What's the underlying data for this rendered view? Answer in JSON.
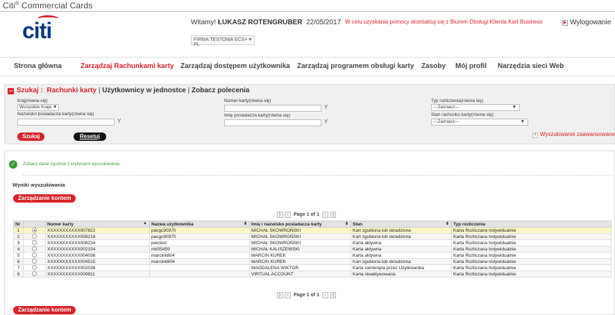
{
  "app": {
    "title_prefix": "Citi",
    "title_sup": "®",
    "title_suffix": " Commercial Cards",
    "logo": "citi"
  },
  "header": {
    "welcome_prefix": "Witamy! ",
    "user_name": "ŁUKASZ ROTENGRUBER",
    "date": "22/05/2017",
    "help_message": "W celu uzyskania pomocy skontaktuj się z Biurem Obsługi Klienta Kart Business",
    "logout_label": "Wylogowanie",
    "company_selected": "FIRMA TESTOWA ECS+ - PL"
  },
  "nav": {
    "items": [
      {
        "label": "Strona główna",
        "active": false
      },
      {
        "label": "Zarządzaj Rachunkami karty",
        "active": true
      },
      {
        "label": "Zarządzaj dostępem użytkownika",
        "active": false
      },
      {
        "label": "Zarządzaj programem obsługi karty",
        "active": false
      },
      {
        "label": "Zasoby",
        "active": false
      },
      {
        "label": "Mój profil",
        "active": false
      },
      {
        "label": "Narzędzia sieci Web",
        "active": false
      }
    ]
  },
  "search": {
    "heading_label": "Szukaj :",
    "tab_active": "Rachunki karty",
    "tab_2": "Użytkownicy w jednostce",
    "tab_3": "Zobacz polecenia",
    "separator": "|",
    "country_label": "Kraj(równa się)",
    "country_value": "Wszystkie Kraje ▼",
    "holder_name_label": "Nazwisko posiadacza karty(równa się)",
    "card_number_label": "Numer karty(równa się)",
    "first_name_label": "Imię posiadacza karty(równa się)",
    "billing_type_label": "Typ rozliczenia(równa się)",
    "billing_type_value": "---Zaznacz---",
    "account_status_label": "Stan rachunku karty(równa się)",
    "account_status_value": "---Zaznacz---",
    "search_button": "Szukaj",
    "reset_button": "Resetuj",
    "advanced_link": "Wyszukiwanie zaawansowane"
  },
  "results": {
    "success_message": "Zobacz dane zgodnie z kryteriami wyszukiwania.",
    "title": "Wyniki wyszukiwania",
    "manage_button": "Zarządzanie kontem",
    "page_text": "Page 1 of 1",
    "columns": [
      "Nr",
      "",
      "Numer karty",
      "Nazwa użytkownika",
      "Imię i nazwisko posiadacza karty",
      "Stan",
      "Typ rozliczenia"
    ],
    "rows": [
      {
        "nr": "1",
        "selected": true,
        "card": "XXXXXXXXXXX007822",
        "user": "pacgc90970",
        "name": "MICHAŁ SKOWROŃSKI",
        "status": "Kart zgubiona lub skradziona",
        "billing": "Karta Rozliczana Indywidualnie"
      },
      {
        "nr": "2",
        "selected": false,
        "card": "XXXXXXXXXXX008218",
        "user": "pacgc90970",
        "name": "MICHAŁ SKOWROŃSKI",
        "status": "Kart zgubiona lub skradziona",
        "billing": "Karta Rozliczana Indywidualnie"
      },
      {
        "nr": "3",
        "selected": false,
        "card": "XXXXXXXXXXX008234",
        "user": "pwctest",
        "name": "MICHAŁ SKOWROŃSKI",
        "status": "Karta aktywna",
        "billing": "Karta Rozliczana Indywidualnie"
      },
      {
        "nr": "4",
        "selected": false,
        "card": "XXXXXXXXXXX002154",
        "user": "mk55459",
        "name": "MICHAŁ KALISZEWSKI",
        "status": "Karta aktywna",
        "billing": "Karta Rozliczana Indywidualnie"
      },
      {
        "nr": "5",
        "selected": false,
        "card": "XXXXXXXXXXX004036",
        "user": "marcink804",
        "name": "MARCIN KUREK",
        "status": "Karta aktywna",
        "billing": "Karta Rozliczana Indywidualnie"
      },
      {
        "nr": "6",
        "selected": false,
        "card": "XXXXXXXXXXX004515",
        "user": "marcink804",
        "name": "MARCIN KUREK",
        "status": "Kart zgubiona lub skradziona",
        "billing": "Karta Rozliczana Indywidualnie"
      },
      {
        "nr": "7",
        "selected": false,
        "card": "XXXXXXXXXXX002038",
        "user": "",
        "name": "MAGDALENA WIKTOR",
        "status": "Karta zamknięta przez Użytkownika",
        "billing": "Karta Rozliczana Indywidualnie"
      },
      {
        "nr": "8",
        "selected": false,
        "card": "XXXXXXXXXXX009811",
        "user": "",
        "name": "VIRTUAL ACCOUNT",
        "status": "Karta nieaktywowana",
        "billing": "Karta Rozliczana Indywidualnie"
      }
    ]
  },
  "colors": {
    "accent_red": "#d8232a",
    "logo_blue": "#0b3a7e",
    "success_green": "#3a9b34",
    "selected_row": "#fdf6c3"
  }
}
